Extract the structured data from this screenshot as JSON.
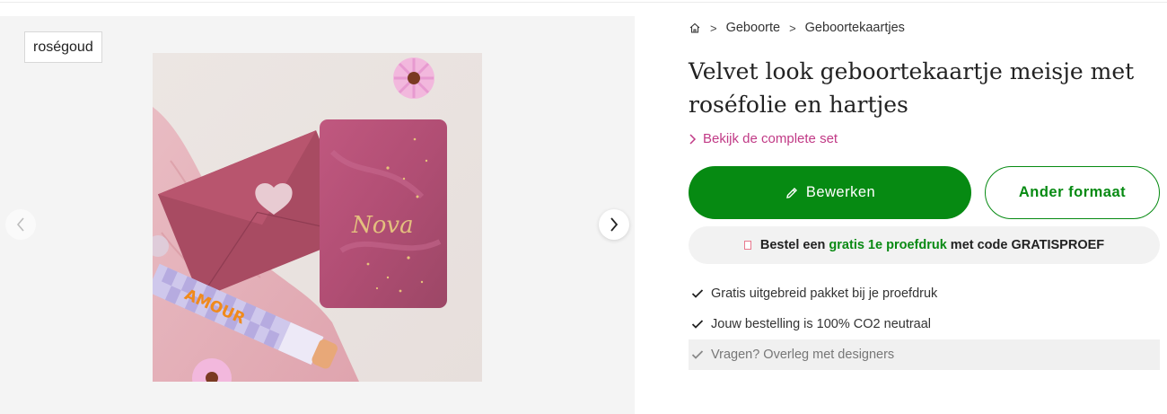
{
  "gallery": {
    "color_tag": "roségoud",
    "image_text": {
      "tape_label": "AMOUR",
      "card_script": "Nova"
    }
  },
  "breadcrumb": {
    "items": [
      "Geboorte",
      "Geboortekaartjes"
    ],
    "separator": ">"
  },
  "product": {
    "title": "Velvet look geboortekaartje meisje met roséfolie en hartjes"
  },
  "set_link": "Bekijk de complete set",
  "buttons": {
    "edit": "Bewerken",
    "format": "Ander formaat"
  },
  "promo": {
    "prefix": "Bestel een",
    "highlight": "gratis 1e proefdruk",
    "suffix": "met code GRATISPROEF"
  },
  "usps": [
    "Gratis uitgebreid pakket bij je proefdruk",
    "Jouw bestelling is 100% CO2 neutraal",
    "Vragen? Overleg met designers"
  ],
  "colors": {
    "primary_green": "#068a12",
    "accent_pink": "#c13a86",
    "promo_green": "#0a8a14"
  }
}
